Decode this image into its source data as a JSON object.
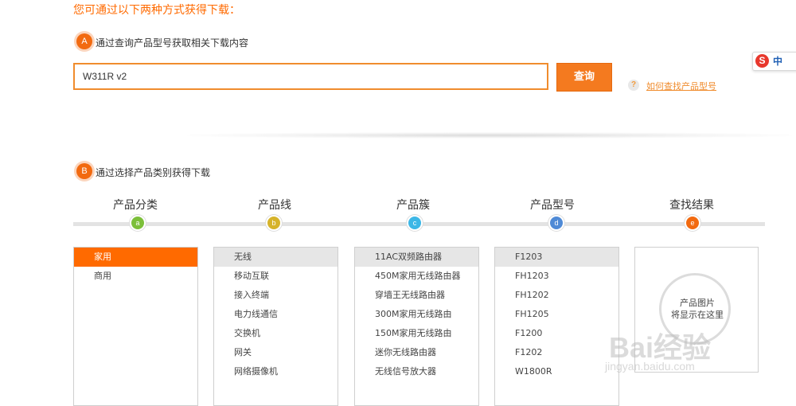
{
  "header": {
    "title": "您可通过以下两种方式获得下载："
  },
  "step_a": {
    "badge": "A",
    "label": "通过查询产品型号获取相关下载内容",
    "search_value": "W311R v2",
    "search_button": "查询",
    "help_icon": "?",
    "help_link": "如何查找产品型号"
  },
  "step_b": {
    "badge": "B",
    "label": "通过选择产品类别获得下载",
    "steps": [
      {
        "label": "产品分类",
        "letter": "a",
        "color": "#7cbf3a"
      },
      {
        "label": "产品线",
        "letter": "b",
        "color": "#d6b32a"
      },
      {
        "label": "产品簇",
        "letter": "c",
        "color": "#3db7e6"
      },
      {
        "label": "产品型号",
        "letter": "d",
        "color": "#4f8ad6"
      },
      {
        "label": "查找结果",
        "letter": "e",
        "color": "#f26a10"
      }
    ]
  },
  "columns": {
    "category": [
      "家用",
      "商用"
    ],
    "product_line": [
      "无线",
      "移动互联",
      "接入终端",
      "电力线通信",
      "交换机",
      "网关",
      "网络摄像机"
    ],
    "product_family": [
      "11AC双频路由器",
      "450M家用无线路由器",
      "穿墙王无线路由器",
      "300M家用无线路由",
      "150M家用无线路由",
      "迷你无线路由器",
      "无线信号放大器"
    ],
    "product_model": [
      "F1203",
      "FH1203",
      "FH1202",
      "FH1205",
      "F1200",
      "F1202",
      "W1800R"
    ]
  },
  "result": {
    "line1": "产品图片",
    "line2": "将显示在这里"
  },
  "ime": {
    "logo": "S",
    "label": "中"
  },
  "watermark": {
    "brand": "Bai经验",
    "url": "jingyan.baidu.com"
  }
}
